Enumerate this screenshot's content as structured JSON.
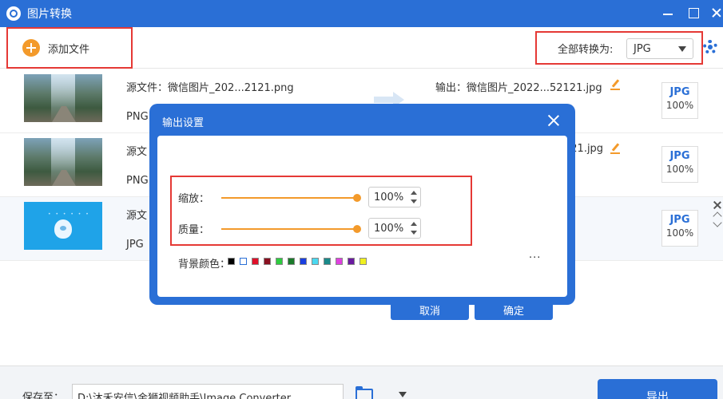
{
  "titlebar": {
    "title": "图片转换"
  },
  "toolbar": {
    "add_file_label": "添加文件",
    "convert_all_label": "全部转换为:",
    "format_value": "JPG"
  },
  "files": [
    {
      "source": "源文件：微信图片_202...2121.png",
      "format": "PNG",
      "output": "输出：微信图片_2022...52121.jpg",
      "target_format": "JPG",
      "quality": "100%"
    },
    {
      "source": "源文",
      "format": "PNG",
      "output": "121.jpg",
      "target_format": "JPG",
      "quality": "100%"
    },
    {
      "source": "源文",
      "format": "JPG",
      "output": "",
      "target_format": "JPG",
      "quality": "100%"
    }
  ],
  "dialog": {
    "title": "输出设置",
    "scale_label": "缩放：",
    "scale_value": "100%",
    "scale_fraction": 1.0,
    "quality_label": "质量：",
    "quality_value": "100%",
    "quality_fraction": 1.0,
    "bg_color_label": "背景颜色：",
    "bg_colors": [
      "#000000",
      "#ffffff",
      "#e0102a",
      "#8a1020",
      "#2ecc40",
      "#1a7a2a",
      "#1a3fe0",
      "#4ad8f0",
      "#1a8a8a",
      "#e040e0",
      "#6a1aa0",
      "#f0f020"
    ],
    "more_label": "···",
    "cancel_label": "取消",
    "confirm_label": "确定"
  },
  "footer": {
    "save_label": "保存至：",
    "save_path": "D:\\沐禾安信\\金狮视频助手\\Image Converter",
    "export_label": "导出"
  },
  "colors": {
    "primary": "#2a6fd6",
    "accent": "#f39a2b",
    "highlight": "#e53935"
  }
}
